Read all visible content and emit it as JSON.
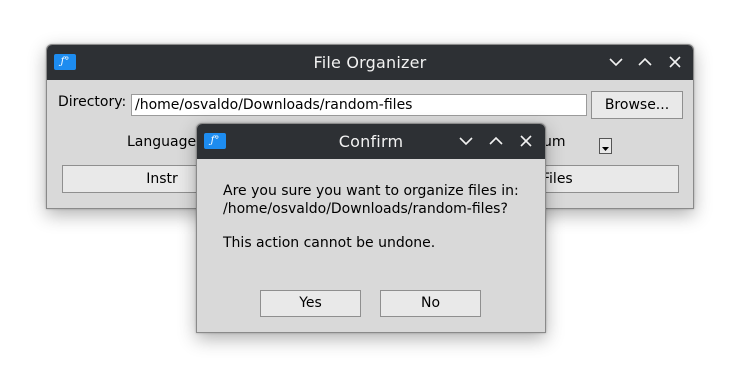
{
  "main_window": {
    "title": "File Organizer",
    "directory_label": "Directory:",
    "directory_value": "/home/osvaldo/Downloads/random-files",
    "browse_label": "Browse...",
    "language_label": "Language",
    "dropdown_visible_text": "um",
    "instructions_button_visible": "Instr",
    "organize_button_visible": "Files",
    "icons": [
      "app-icon",
      "minimize-icon",
      "maximize-icon",
      "close-icon",
      "dropdown-arrow-icon"
    ]
  },
  "dialog": {
    "title": "Confirm",
    "message_line1": "Are you sure you want to organize files in:",
    "message_line2": "/home/osvaldo/Downloads/random-files?",
    "message_line3": "This action cannot be undone.",
    "yes_label": "Yes",
    "no_label": "No",
    "icons": [
      "app-icon",
      "minimize-icon",
      "maximize-icon",
      "close-icon"
    ]
  },
  "colors": {
    "titlebar": "#2d3034",
    "window_bg": "#d9d9d9",
    "accent_icon": "#1d8cf0"
  }
}
